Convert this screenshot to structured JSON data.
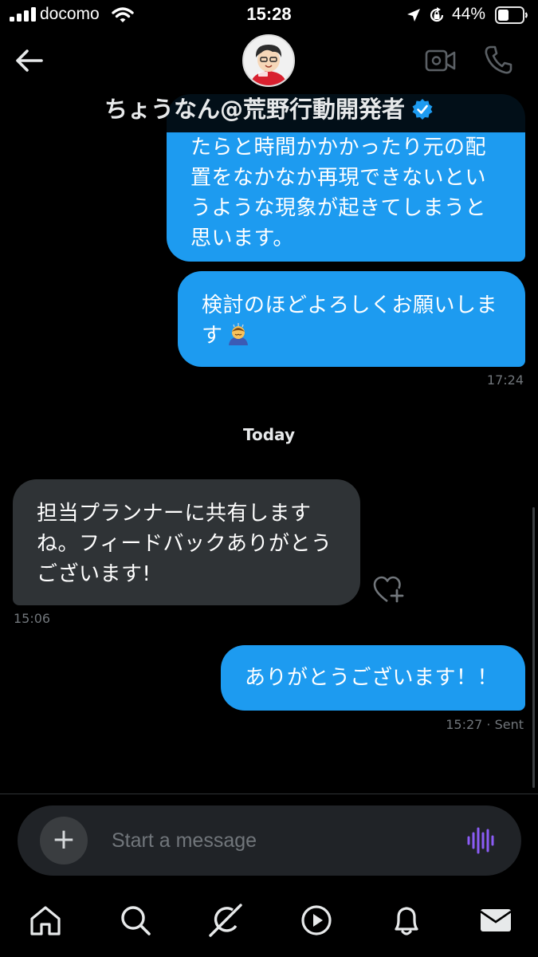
{
  "status_bar": {
    "carrier": "docomo",
    "time": "15:28",
    "battery": "44%"
  },
  "header": {
    "contact_name": "ちょうなん@荒野行動開発者",
    "verified": true,
    "icons": [
      "back-arrow-icon",
      "video-call-icon",
      "phone-icon",
      "verified-badge-icon"
    ]
  },
  "conversation": {
    "messages": [
      {
        "direction": "sent",
        "text": "たらと時間かかかったり元の配\n置をなかなか再現できないとい\nうような現象が起きてしまうと\n思います。"
      },
      {
        "direction": "sent",
        "text": "検討のほどよろしくお願いしま\nす",
        "emoji": "bowing-person-emoji",
        "time": "17:24"
      },
      {
        "direction": "received",
        "text": "担当プランナーに共有します\nね。フィードバックありがとう\nございます!",
        "time": "15:06"
      },
      {
        "direction": "sent",
        "text": "ありがとうございます！！",
        "time": "15:27 · Sent"
      }
    ],
    "day_divider": "Today"
  },
  "composer": {
    "placeholder": "Start a message",
    "icons": [
      "plus-icon",
      "voice-wave-icon"
    ]
  },
  "bottom_nav": {
    "items": [
      "home-icon",
      "search-icon",
      "grok-icon",
      "video-icon",
      "notifications-icon",
      "messages-icon"
    ]
  },
  "colors": {
    "sent_bubble": "#1d9bf0",
    "received_bubble": "#2f3336",
    "background": "#000000",
    "voice_accent": "#8b5cf6"
  }
}
